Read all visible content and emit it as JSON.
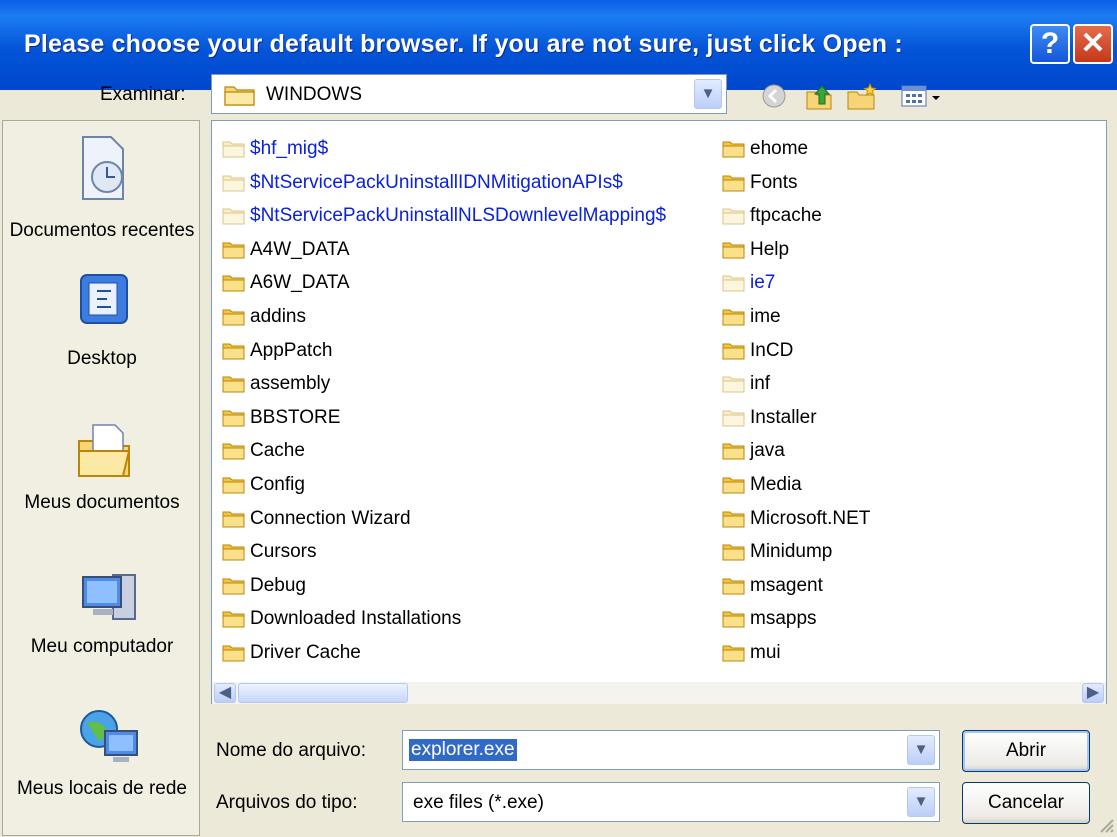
{
  "window": {
    "title": "Please choose your default browser. If you are not sure, just click Open :",
    "help_symbol": "?",
    "close_symbol": "✕"
  },
  "lookin": {
    "label": "Examinar:",
    "value": "WINDOWS",
    "toolbar_icons": [
      "back-icon",
      "up-folder-icon",
      "new-folder-icon",
      "view-menu-icon"
    ]
  },
  "places": [
    {
      "label": "Documentos recentes",
      "icon": "recent-documents-icon"
    },
    {
      "label": "Desktop",
      "icon": "desktop-icon"
    },
    {
      "label": "Meus documentos",
      "icon": "my-documents-icon"
    },
    {
      "label": "Meu computador",
      "icon": "my-computer-icon"
    },
    {
      "label": "Meus locais de rede",
      "icon": "network-places-icon"
    }
  ],
  "files": {
    "column1": [
      {
        "name": "$hf_mig$",
        "hidden": true
      },
      {
        "name": "$NtServicePackUninstallIDNMitigationAPIs$",
        "hidden": true
      },
      {
        "name": "$NtServicePackUninstallNLSDownlevelMapping$",
        "hidden": true
      },
      {
        "name": "A4W_DATA",
        "hidden": false
      },
      {
        "name": "A6W_DATA",
        "hidden": false
      },
      {
        "name": "addins",
        "hidden": false
      },
      {
        "name": "AppPatch",
        "hidden": false
      },
      {
        "name": "assembly",
        "hidden": false
      },
      {
        "name": "BBSTORE",
        "hidden": false
      },
      {
        "name": "Cache",
        "hidden": false
      },
      {
        "name": "Config",
        "hidden": false
      },
      {
        "name": "Connection Wizard",
        "hidden": false
      },
      {
        "name": "Cursors",
        "hidden": false
      },
      {
        "name": "Debug",
        "hidden": false
      },
      {
        "name": "Downloaded Installations",
        "hidden": false
      },
      {
        "name": "Driver Cache",
        "hidden": false
      }
    ],
    "column2": [
      {
        "name": "ehome",
        "hidden": false
      },
      {
        "name": "Fonts",
        "hidden": false
      },
      {
        "name": "ftpcache",
        "hidden": true
      },
      {
        "name": "Help",
        "hidden": false
      },
      {
        "name": "ie7",
        "hidden": true
      },
      {
        "name": "ime",
        "hidden": false
      },
      {
        "name": "InCD",
        "hidden": false
      },
      {
        "name": "inf",
        "hidden": true
      },
      {
        "name": "Installer",
        "hidden": true
      },
      {
        "name": "java",
        "hidden": false
      },
      {
        "name": "Media",
        "hidden": false
      },
      {
        "name": "Microsoft.NET",
        "hidden": false
      },
      {
        "name": "Minidump",
        "hidden": false
      },
      {
        "name": "msagent",
        "hidden": false
      },
      {
        "name": "msapps",
        "hidden": false
      },
      {
        "name": "mui",
        "hidden": false
      }
    ]
  },
  "filename": {
    "label": "Nome do arquivo:",
    "value": "explorer.exe"
  },
  "filetype": {
    "label": "Arquivos do tipo:",
    "value": "exe files (*.exe)"
  },
  "buttons": {
    "open": "Abrir",
    "cancel": "Cancelar"
  },
  "colors": {
    "title_bar": "#0454d7",
    "hidden_item_text": "#0a22d8",
    "selection": "#316ac5"
  }
}
